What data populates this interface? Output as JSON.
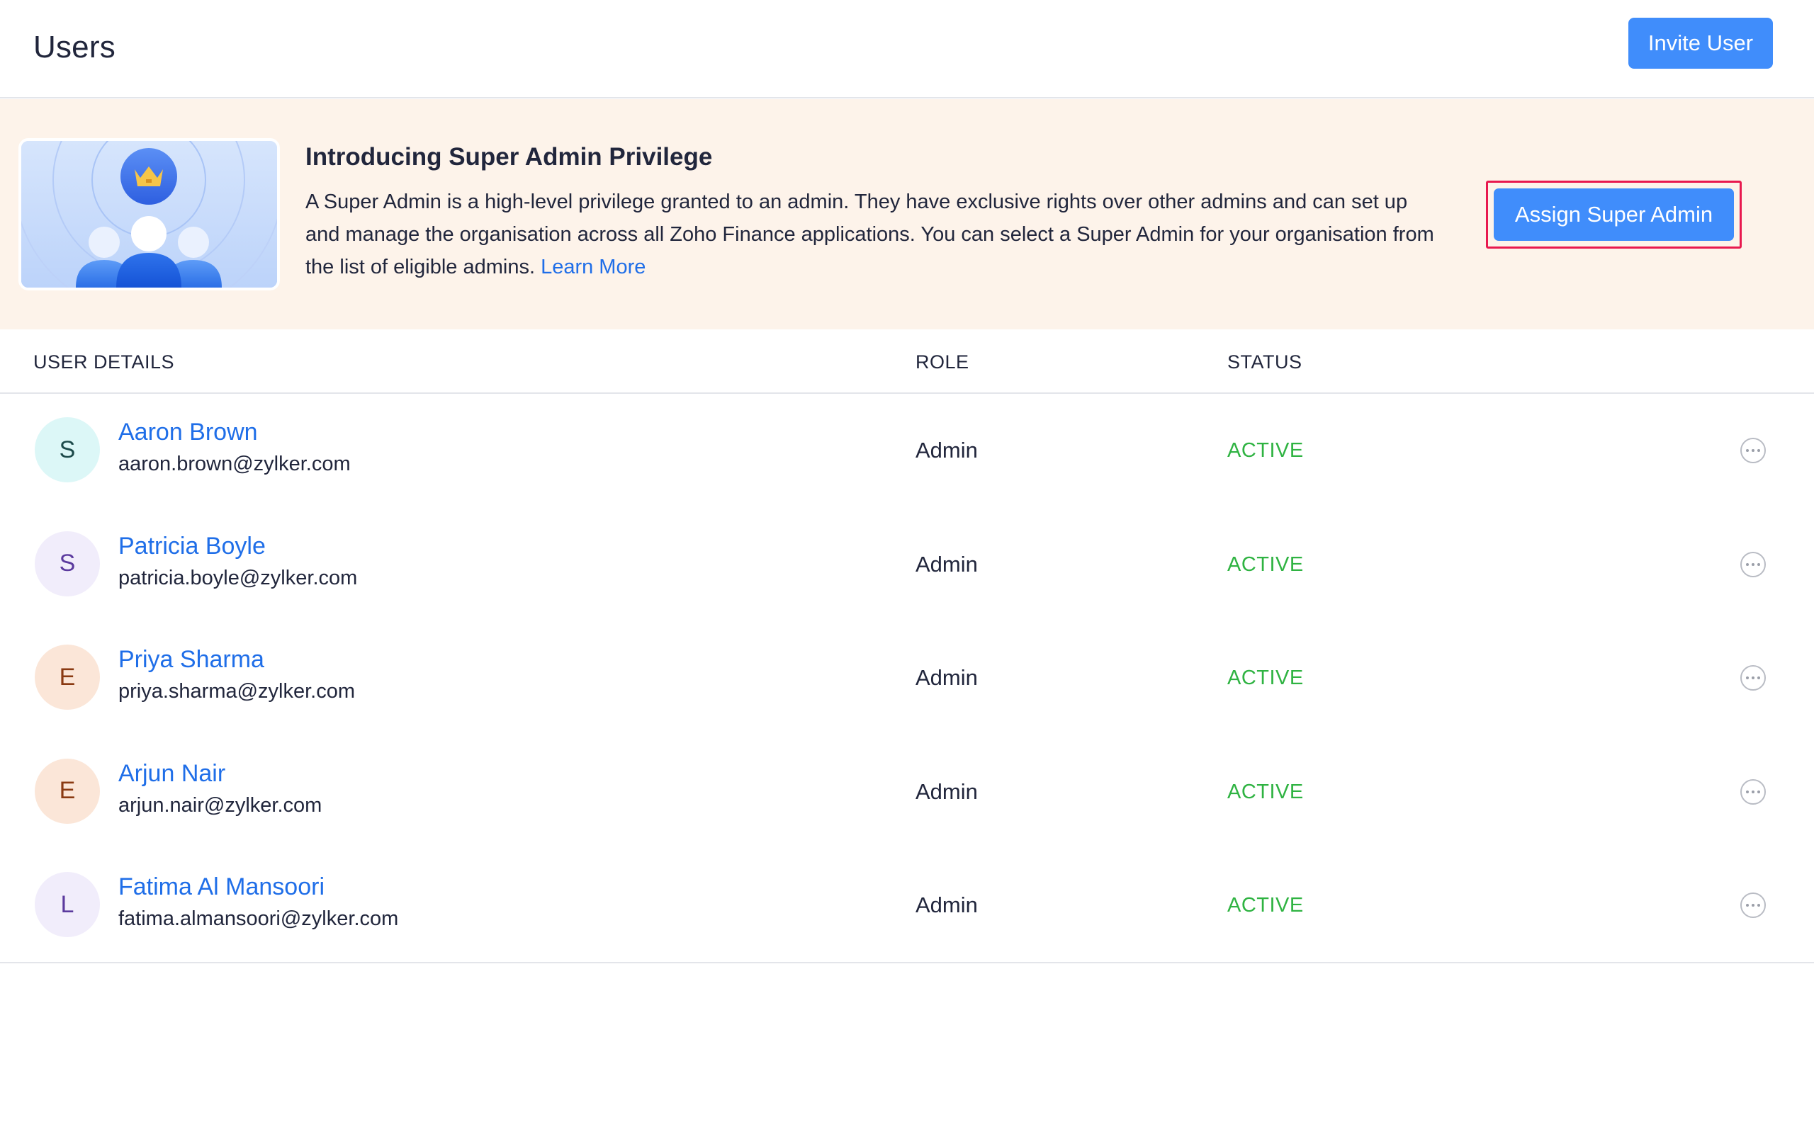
{
  "header": {
    "title": "Users",
    "invite_label": "Invite User"
  },
  "banner": {
    "heading": "Introducing Super Admin Privilege",
    "text": "A Super Admin is a high-level privilege granted to an admin. They have exclusive rights over other admins and can set up and manage the organisation across all Zoho Finance applications. You can select a Super Admin for your organisation from the list of eligible admins.",
    "learn_more_label": "Learn More",
    "assign_label": "Assign Super Admin",
    "illustration_icon": "crown-icon"
  },
  "table": {
    "columns": {
      "user_details": "USER DETAILS",
      "role": "ROLE",
      "status": "STATUS"
    },
    "rows": [
      {
        "initial": "S",
        "name": "Aaron Brown",
        "email": "aaron.brown@zylker.com",
        "role": "Admin",
        "status": "ACTIVE",
        "avatar_bg": "#dcf7f7",
        "avatar_fg": "#1c4a4a"
      },
      {
        "initial": "S",
        "name": "Patricia Boyle",
        "email": "patricia.boyle@zylker.com",
        "role": "Admin",
        "status": "ACTIVE",
        "avatar_bg": "#f1edfb",
        "avatar_fg": "#5b3a9e"
      },
      {
        "initial": "E",
        "name": "Priya Sharma",
        "email": "priya.sharma@zylker.com",
        "role": "Admin",
        "status": "ACTIVE",
        "avatar_bg": "#fbe6d8",
        "avatar_fg": "#8a3a12"
      },
      {
        "initial": "E",
        "name": "Arjun Nair",
        "email": "arjun.nair@zylker.com",
        "role": "Admin",
        "status": "ACTIVE",
        "avatar_bg": "#fbe6d8",
        "avatar_fg": "#8a3a12"
      },
      {
        "initial": "L",
        "name": "Fatima Al Mansoori",
        "email": "fatima.almansoori@zylker.com",
        "role": "Admin",
        "status": "ACTIVE",
        "avatar_bg": "#f1edfb",
        "avatar_fg": "#5b3a9e"
      }
    ]
  },
  "colors": {
    "accent": "#408dfb",
    "link": "#1f6ee8",
    "status_active": "#2fb342",
    "banner_bg": "#fdf3ea",
    "highlight_border": "#e8194f"
  }
}
